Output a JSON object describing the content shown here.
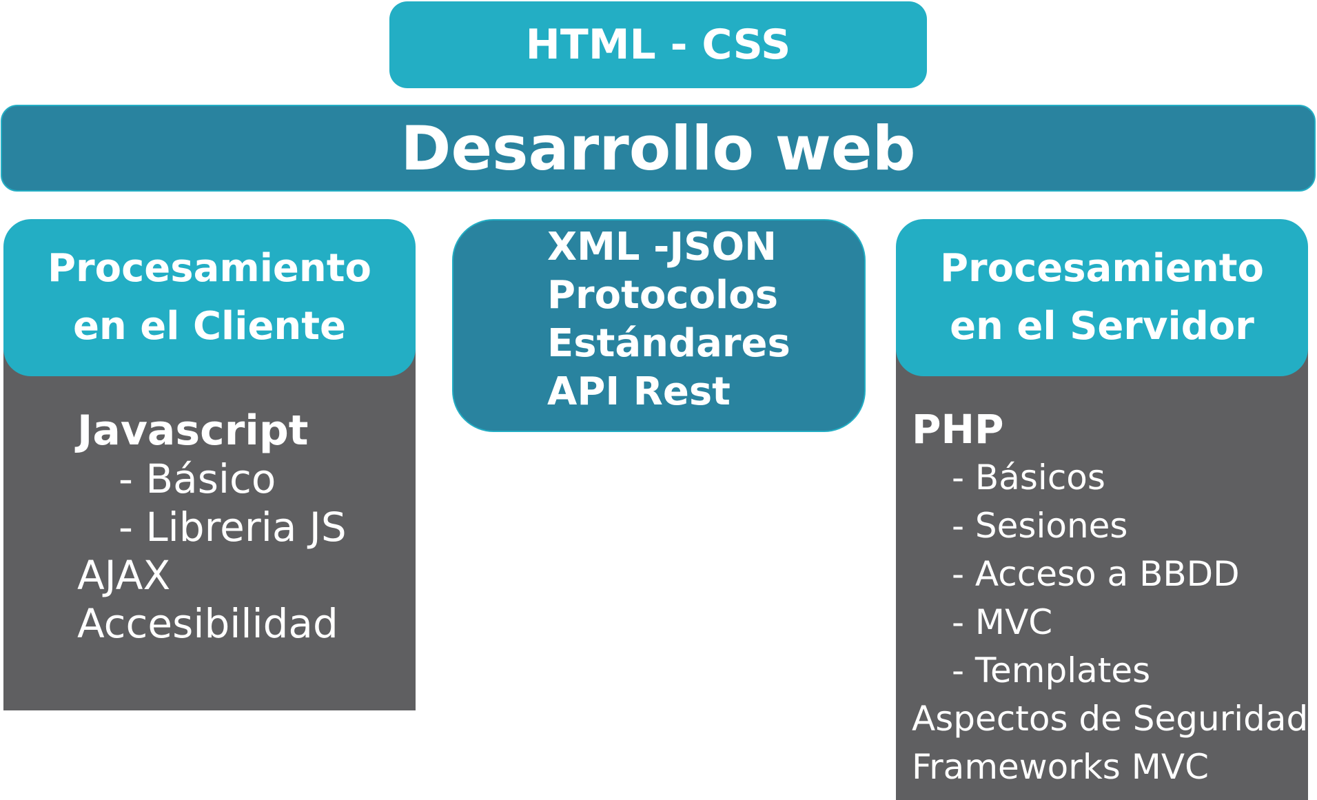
{
  "top_box": {
    "label": "HTML - CSS"
  },
  "title_bar": {
    "label": "Desarrollo web"
  },
  "left": {
    "header_line1": "Procesamiento",
    "header_line2": "en el Cliente",
    "items": [
      {
        "text": "Javascript",
        "style": "bold"
      },
      {
        "text": "- Básico",
        "style": "sub"
      },
      {
        "text": "- Libreria JS",
        "style": "sub"
      },
      {
        "text": "AJAX",
        "style": "plain"
      },
      {
        "text": "Accesibilidad",
        "style": "plain"
      }
    ]
  },
  "middle": {
    "items": [
      "XML -JSON",
      "Protocolos",
      "Estándares",
      "API Rest"
    ]
  },
  "right": {
    "header_line1": "Procesamiento",
    "header_line2": "en el Servidor",
    "items": [
      {
        "text": "PHP",
        "style": "bold"
      },
      {
        "text": "- Básicos",
        "style": "sub"
      },
      {
        "text": "- Sesiones",
        "style": "sub"
      },
      {
        "text": "- Acceso a BBDD",
        "style": "sub"
      },
      {
        "text": "- MVC",
        "style": "sub"
      },
      {
        "text": "- Templates",
        "style": "sub"
      },
      {
        "text": "Aspectos de Seguridad",
        "style": "plain"
      },
      {
        "text": "Frameworks MVC",
        "style": "plain"
      }
    ]
  },
  "colors": {
    "teal_light": "#23aec4",
    "teal_dark": "#29839f",
    "panel_gray": "#5f5f61",
    "text": "#ffffff"
  }
}
